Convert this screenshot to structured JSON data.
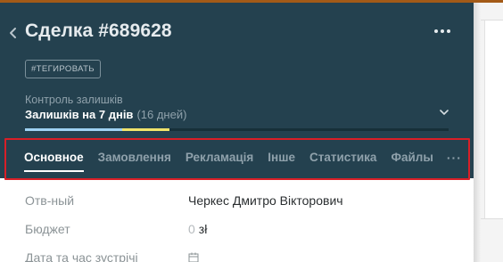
{
  "lead": {
    "title": "Сделка #689628",
    "tag_button": "#ТЕГИРОВАТЬ"
  },
  "stock": {
    "label": "Контроль залишків",
    "value": "Залишків на 7 днів",
    "extra": "(16 дней)",
    "progress": {
      "blue_fraction": 0.23,
      "yellow_fraction": 0.11
    }
  },
  "tabs": [
    {
      "label": "Основное",
      "active": true
    },
    {
      "label": "Замовлення",
      "active": false
    },
    {
      "label": "Рекламація",
      "active": false
    },
    {
      "label": "Інше",
      "active": false
    },
    {
      "label": "Статистика",
      "active": false
    },
    {
      "label": "Файлы",
      "active": false
    }
  ],
  "tabs_more": "···",
  "fields": {
    "responsible": {
      "label": "Отв-ный",
      "value": "Черкес Дмитро Вікторович"
    },
    "budget": {
      "label": "Бюджет",
      "value": "0",
      "currency": "зł"
    },
    "meeting": {
      "label": "Дата та час зустрічі"
    }
  },
  "icons": {
    "back": "chevron-left-icon",
    "more": "ellipsis-icon",
    "expand": "chevron-down-icon",
    "calendar": "calendar-icon"
  },
  "colors": {
    "header_bg": "#24414f",
    "highlight_border": "#d91f27",
    "progress_blue": "#9fd2f3",
    "progress_yellow": "#f2e46b",
    "top_accent": "#a35a17"
  }
}
